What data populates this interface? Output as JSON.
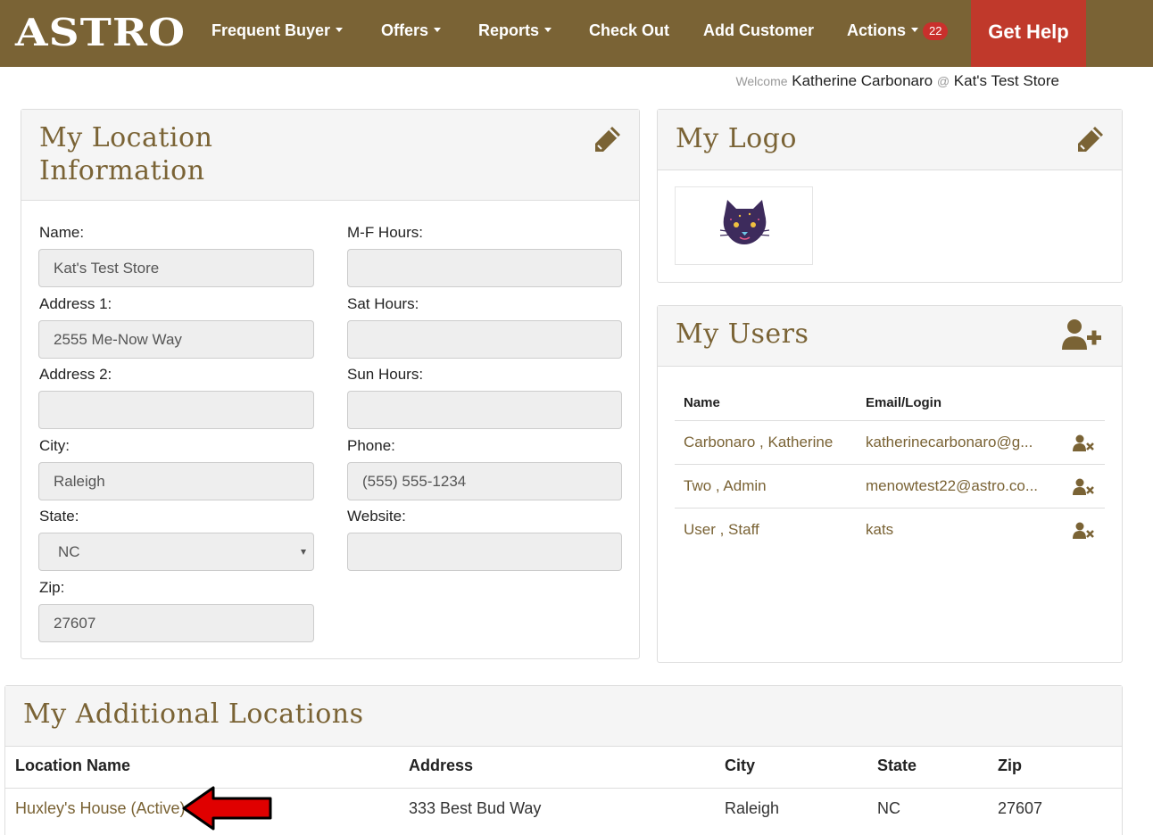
{
  "nav": {
    "brand": "ASTRO",
    "items": [
      {
        "label": "Frequent Buyer",
        "dropdown": true
      },
      {
        "label": "Offers",
        "dropdown": true
      },
      {
        "label": "Reports",
        "dropdown": true
      },
      {
        "label": "Check Out",
        "dropdown": false
      },
      {
        "label": "Add Customer",
        "dropdown": false
      },
      {
        "label": "Actions",
        "dropdown": true,
        "badge": "22"
      }
    ],
    "help": "Get Help"
  },
  "welcome": {
    "prefix": "Welcome",
    "user": "Katherine Carbonaro",
    "at": "@",
    "store": "Kat's Test Store"
  },
  "location_panel": {
    "title_line1": "My Location",
    "title_line2": "Information",
    "icon": "pencil-icon",
    "fields": {
      "name": {
        "label": "Name:",
        "value": "Kat's Test Store"
      },
      "address1": {
        "label": "Address 1:",
        "value": "2555 Me-Now Way"
      },
      "address2": {
        "label": "Address 2:",
        "value": ""
      },
      "city": {
        "label": "City:",
        "value": "Raleigh"
      },
      "state": {
        "label": "State:",
        "value": "NC"
      },
      "zip": {
        "label": "Zip:",
        "value": "27607"
      },
      "mf_hours": {
        "label": "M-F Hours:",
        "value": ""
      },
      "sat_hours": {
        "label": "Sat Hours:",
        "value": ""
      },
      "sun_hours": {
        "label": "Sun Hours:",
        "value": ""
      },
      "phone": {
        "label": "Phone:",
        "value": "(555) 555-1234"
      },
      "website": {
        "label": "Website:",
        "value": ""
      }
    }
  },
  "logo_panel": {
    "title": "My Logo",
    "icon": "pencil-icon",
    "logo": "cat-logo"
  },
  "users_panel": {
    "title": "My Users",
    "icon": "add-user-icon",
    "columns": [
      "Name",
      "Email/Login"
    ],
    "rows": [
      {
        "name": "Carbonaro , Katherine",
        "email": "katherinecarbonaro@g..."
      },
      {
        "name": "Two , Admin",
        "email": "menowtest22@astro.co..."
      },
      {
        "name": "User , Staff",
        "email": "kats"
      }
    ],
    "row_icon": "remove-user-icon"
  },
  "locations_panel": {
    "title": "My Additional Locations",
    "columns": [
      "Location Name",
      "Address",
      "City",
      "State",
      "Zip"
    ],
    "rows": [
      {
        "name": "Huxley's House (Active)",
        "address": "333 Best Bud Way",
        "city": "Raleigh",
        "state": "NC",
        "zip": "27607"
      }
    ]
  },
  "colors": {
    "brand_brown": "#7a6335",
    "help_red": "#c0392b",
    "badge_red": "#c9302c",
    "arrow_red": "#e00000"
  }
}
